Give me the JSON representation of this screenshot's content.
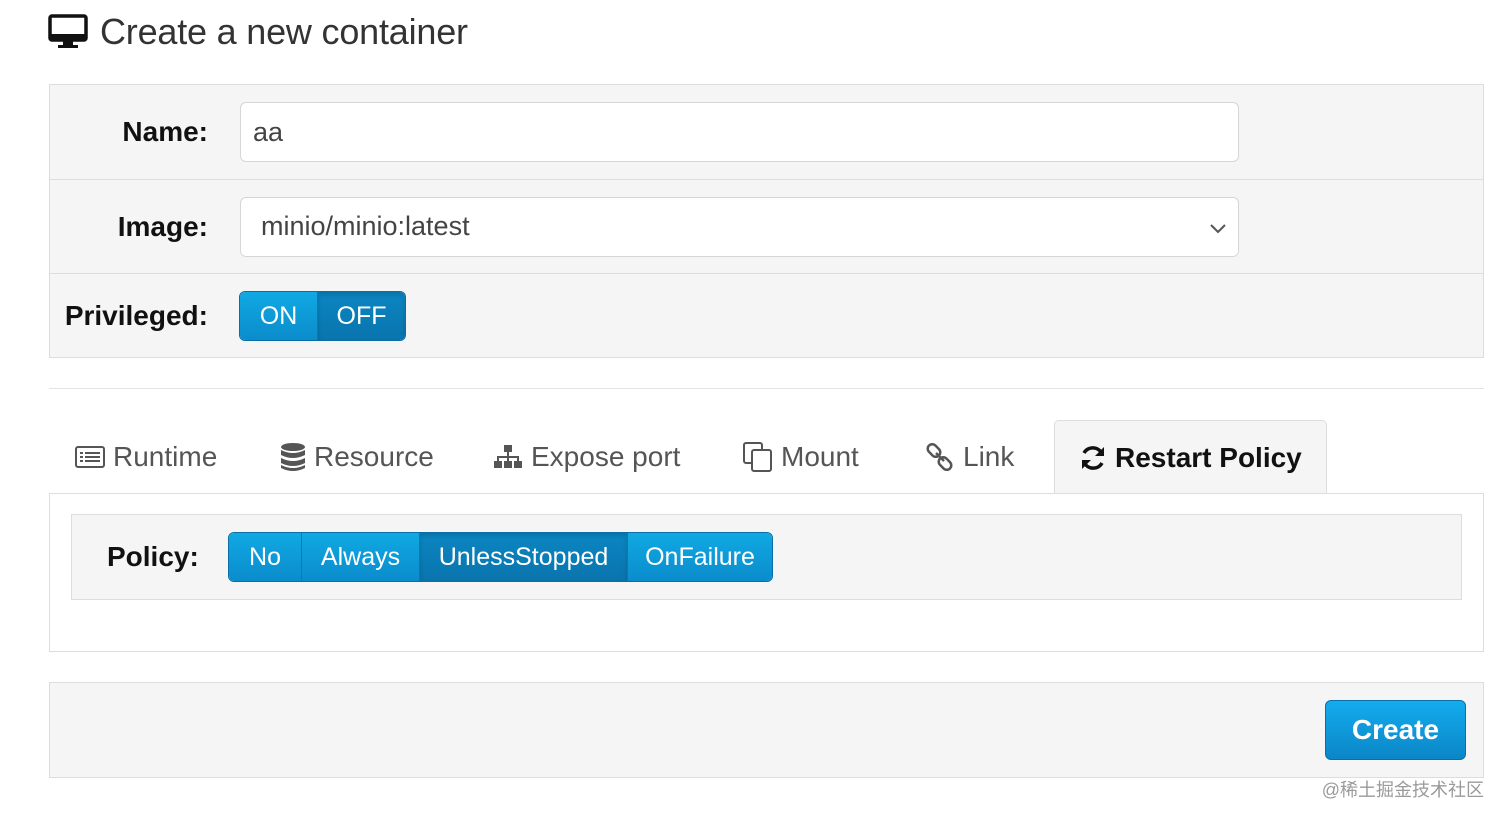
{
  "header": {
    "title": "Create a new container",
    "icon": "monitor-icon"
  },
  "form": {
    "name": {
      "label": "Name:",
      "value": "aa"
    },
    "image": {
      "label": "Image:",
      "value": "minio/minio:latest"
    },
    "privileged": {
      "label": "Privileged:",
      "options": [
        "ON",
        "OFF"
      ],
      "selected": "OFF"
    }
  },
  "tabs": [
    {
      "label": "Runtime",
      "icon": "list-icon"
    },
    {
      "label": "Resource",
      "icon": "database-icon"
    },
    {
      "label": "Expose port",
      "icon": "sitemap-icon"
    },
    {
      "label": "Mount",
      "icon": "copy-icon"
    },
    {
      "label": "Link",
      "icon": "link-icon"
    },
    {
      "label": "Restart Policy",
      "icon": "refresh-icon",
      "active": true
    }
  ],
  "restart_policy": {
    "label": "Policy:",
    "options": [
      "No",
      "Always",
      "UnlessStopped",
      "OnFailure"
    ],
    "selected": "UnlessStopped"
  },
  "footer": {
    "create_label": "Create"
  },
  "watermark": "@稀土掘金技术社区",
  "colors": {
    "accent": "#0b8ccc",
    "panel_bg": "#f5f5f5",
    "border": "#dddddd"
  }
}
